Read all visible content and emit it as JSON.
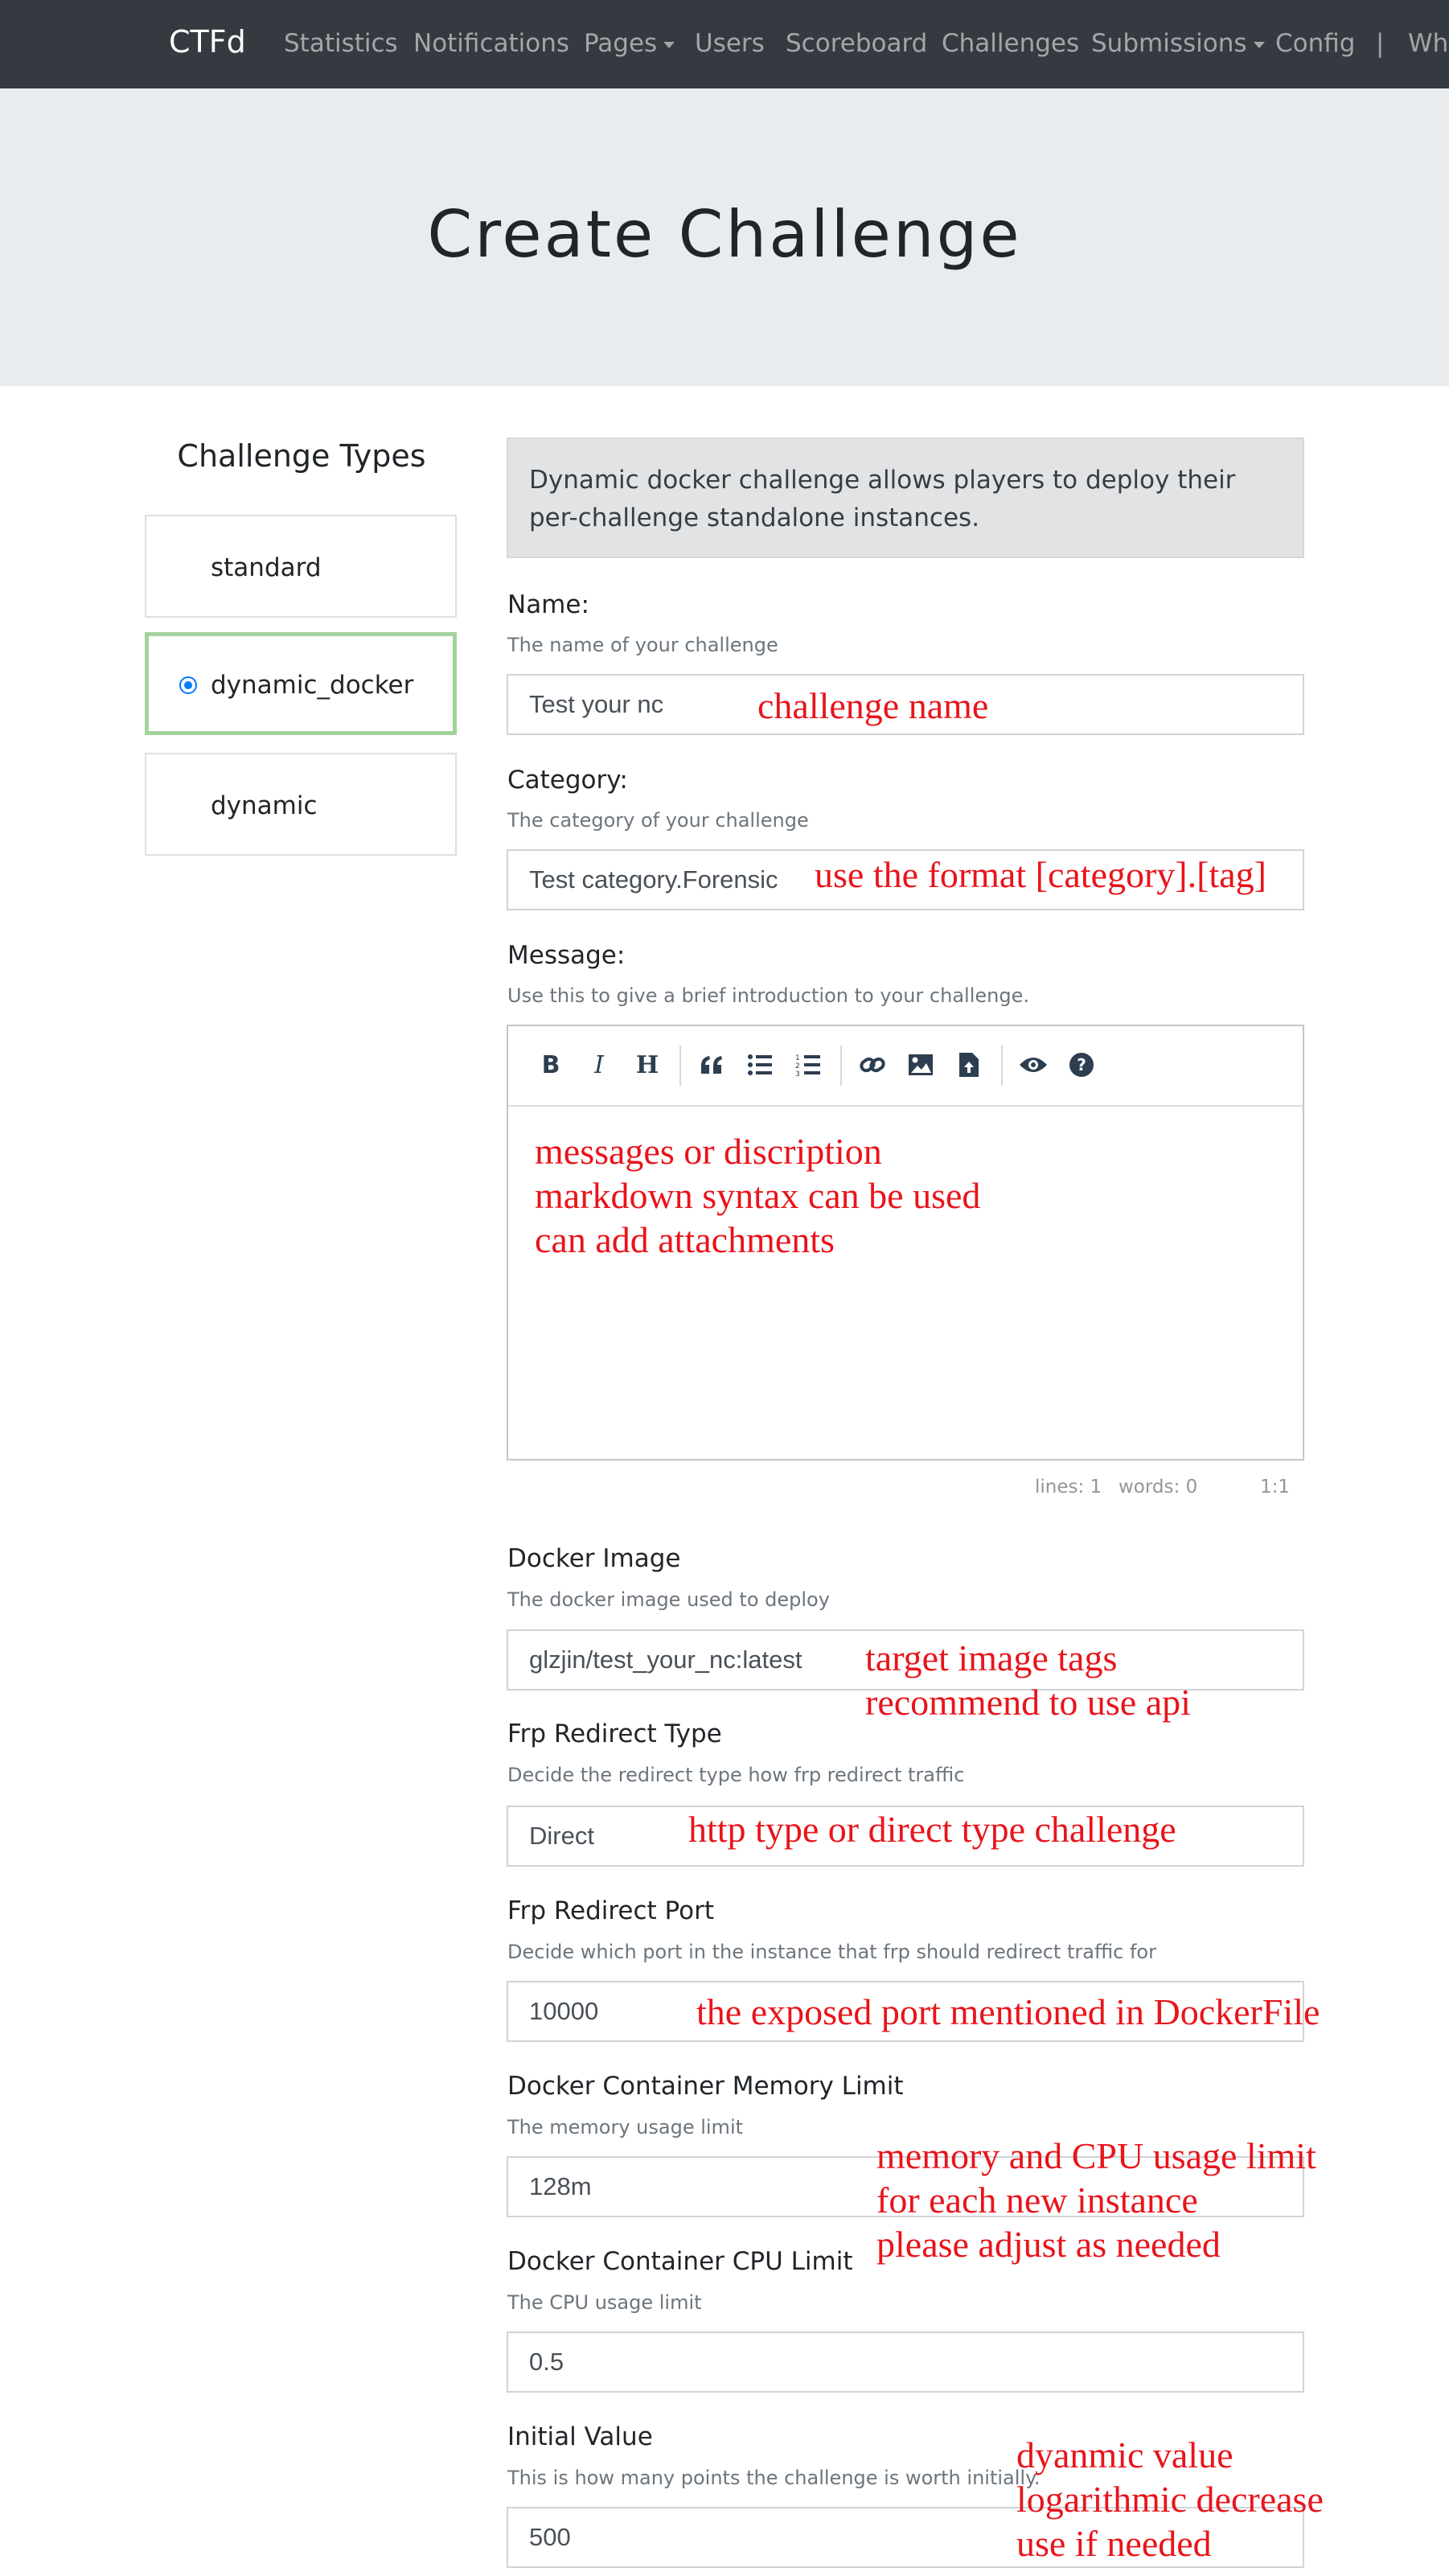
{
  "navbar": {
    "brand": "CTFd",
    "items": [
      "Statistics",
      "Notifications",
      "Pages",
      "Users",
      "Scoreboard",
      "Challenges",
      "Submissions",
      "Config",
      "|",
      "Wh"
    ]
  },
  "page_title": "Create Challenge",
  "sidebar": {
    "title": "Challenge Types",
    "types": [
      {
        "label": "standard",
        "selected": false
      },
      {
        "label": "dynamic_docker",
        "selected": true
      },
      {
        "label": "dynamic",
        "selected": false
      }
    ]
  },
  "info": "Dynamic docker challenge allows players to deploy their per-challenge standalone instances.",
  "fields": {
    "name": {
      "label": "Name:",
      "help": "The name of your challenge",
      "value": "Test your nc"
    },
    "category": {
      "label": "Category:",
      "help": "The category of your challenge",
      "value": "Test category.Forensic"
    },
    "message": {
      "label": "Message:",
      "help": "Use this to give a brief introduction to your challenge."
    },
    "docker_image": {
      "label": "Docker Image",
      "help": "The docker image used to deploy",
      "value": "glzjin/test_your_nc:latest"
    },
    "frp_type": {
      "label": "Frp Redirect Type",
      "help": "Decide the redirect type how frp redirect traffic",
      "value": "Direct"
    },
    "frp_port": {
      "label": "Frp Redirect Port",
      "help": "Decide which port in the instance that frp should redirect traffic for",
      "value": "10000"
    },
    "memory": {
      "label": "Docker Container Memory Limit",
      "help": "The memory usage limit",
      "value": "128m"
    },
    "cpu": {
      "label": "Docker Container CPU Limit",
      "help": "The CPU usage limit",
      "value": "0.5"
    },
    "initial": {
      "label": "Initial Value",
      "help": "This is how many points the challenge is worth initially.",
      "value": "500"
    }
  },
  "editor": {
    "toolbar_icons": [
      "bold-icon",
      "italic-icon",
      "heading-icon",
      "quote-icon",
      "unordered-list-icon",
      "ordered-list-icon",
      "link-icon",
      "image-icon",
      "upload-file-icon",
      "preview-icon",
      "help-icon"
    ],
    "status": {
      "lines": "lines: 1",
      "words": "words: 0",
      "cursor": "1:1"
    }
  },
  "annotations": {
    "name": "challenge name",
    "category": "use the format [category].[tag]",
    "message": [
      "messages or discription",
      "markdown syntax can be used",
      "can add attachments"
    ],
    "docker_image": [
      "target image tags",
      "recommend to use api"
    ],
    "frp_type": "http type or direct type challenge",
    "frp_port": "the exposed port mentioned in DockerFile",
    "limits": [
      "memory and CPU usage limit",
      "for each new instance",
      "please adjust as needed"
    ],
    "initial": [
      "dyanmic value",
      "logarithmic decrease",
      "use if needed"
    ]
  },
  "colors": {
    "navbar": "#343a40",
    "jumbotron": "#e9ecef",
    "annotation": "#e8141b",
    "selected_border": "#a3d39c",
    "radio": "#007bff"
  }
}
